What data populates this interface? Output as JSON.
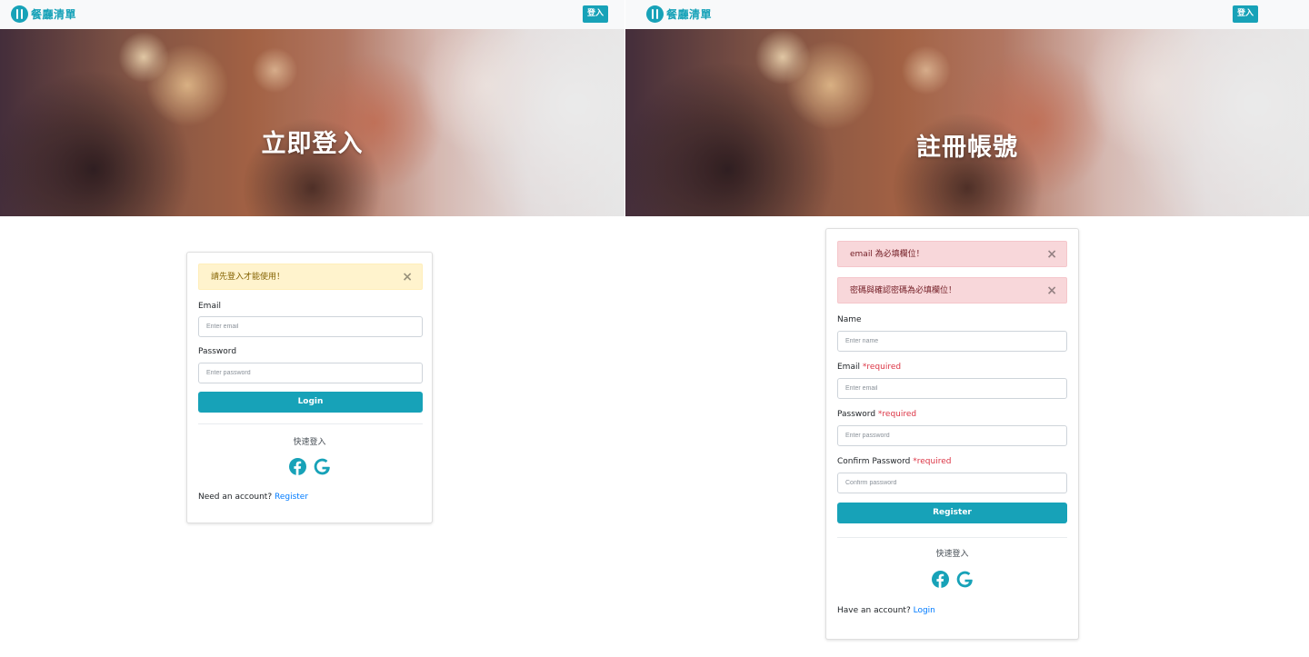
{
  "brand": {
    "name": "餐廳清單"
  },
  "nav": {
    "login_button": "登入"
  },
  "login_page": {
    "hero_title": "立即登入",
    "alert": {
      "text": "請先登入才能使用！",
      "close": "×"
    },
    "email": {
      "label": "Email",
      "placeholder": "Enter email"
    },
    "password": {
      "label": "Password",
      "placeholder": "Enter password"
    },
    "submit": "Login",
    "quick_login": "快速登入",
    "footer": {
      "prompt": "Need an account?",
      "link": "Register"
    }
  },
  "register_page": {
    "hero_title": "註冊帳號",
    "alerts": [
      {
        "text": "email 為必填欄位！",
        "close": "×"
      },
      {
        "text": "密碼與確認密碼為必填欄位！",
        "close": "×"
      }
    ],
    "name": {
      "label": "Name",
      "placeholder": "Enter name"
    },
    "email": {
      "label": "Email",
      "required": "*required",
      "placeholder": "Enter email"
    },
    "password": {
      "label": "Password",
      "required": "*required",
      "placeholder": "Enter password"
    },
    "confirm": {
      "label": "Confirm Password",
      "required": "*required",
      "placeholder": "Confirm password"
    },
    "submit": "Register",
    "quick_login": "快速登入",
    "footer": {
      "prompt": "Have an account?",
      "link": "Login"
    }
  },
  "icons": {
    "facebook": "facebook-icon",
    "google": "google-icon"
  },
  "colors": {
    "accent": "#17a2b8",
    "link": "#007bff",
    "required": "#dc3545",
    "warning_bg": "#fff3cd",
    "danger_bg": "#f8d7da"
  }
}
